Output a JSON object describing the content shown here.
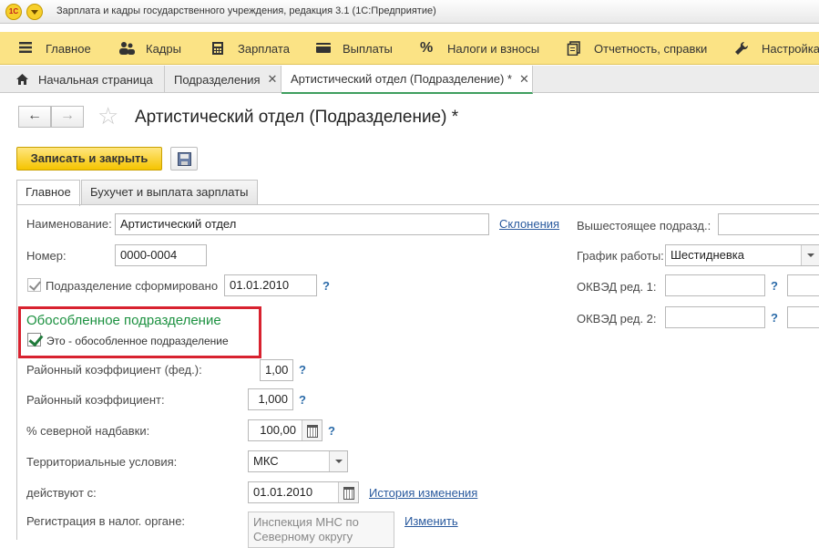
{
  "titlebar": {
    "logo_text": "1C",
    "title": "Зарплата и кадры государственного учреждения, редакция 3.1  (1С:Предприятие)"
  },
  "sections": [
    {
      "label": "Главное",
      "icon": "hamburger-icon"
    },
    {
      "label": "Кадры",
      "icon": "people-icon"
    },
    {
      "label": "Зарплата",
      "icon": "calculator-icon"
    },
    {
      "label": "Выплаты",
      "icon": "wallet-icon"
    },
    {
      "label": "Налоги и взносы",
      "icon": "percent-icon"
    },
    {
      "label": "Отчетность, справки",
      "icon": "reports-icon"
    },
    {
      "label": "Настройка",
      "icon": "wrench-icon"
    }
  ],
  "tabs": [
    {
      "label": "Начальная страница",
      "icon": "home-icon"
    },
    {
      "label": "Подразделения",
      "close": "✕"
    },
    {
      "label": "Артистический отдел (Подразделение) *",
      "close": "✕"
    }
  ],
  "toolbar": {
    "back_icon": "←",
    "forward_icon": "→",
    "star_icon": "☆",
    "title": "Артистический отдел (Подразделение) *",
    "save_close_label": "Записать и закрыть"
  },
  "form_tabs": [
    "Главное",
    "Бухучет и выплата зарплаты"
  ],
  "form": {
    "name_label": "Наименование:",
    "name_value": "Артистический отдел",
    "declensions_link": "Склонения",
    "number_label": "Номер:",
    "number_value": "0000-0004",
    "formed_label": "Подразделение сформировано",
    "formed_date": "01.01.2010",
    "separate_heading": "Обособленное подразделение",
    "separate_checkbox_label": "Это - обособленное подразделение",
    "district_fed_label": "Районный коэффициент (фед.):",
    "district_fed_value": "1,00",
    "district_label": "Районный коэффициент:",
    "district_value": "1,000",
    "northern_label": "% северной надбавки:",
    "northern_value": "100,00",
    "territorial_label": "Территориальные условия:",
    "territorial_value": "МКС",
    "effective_label": "действуют с:",
    "effective_date": "01.01.2010",
    "history_link": "История изменения",
    "tax_reg_label": "Регистрация в налог. органе:",
    "tax_reg_value": "Инспекция МНС по Северному округу",
    "change_link": "Изменить",
    "parent_label": "Вышестоящее подразд.:",
    "parent_value": "",
    "schedule_label": "График работы:",
    "schedule_value": "Шестидневка",
    "okved1_label": "ОКВЭД ред. 1:",
    "okved2_label": "ОКВЭД ред. 2:",
    "question": "?"
  }
}
